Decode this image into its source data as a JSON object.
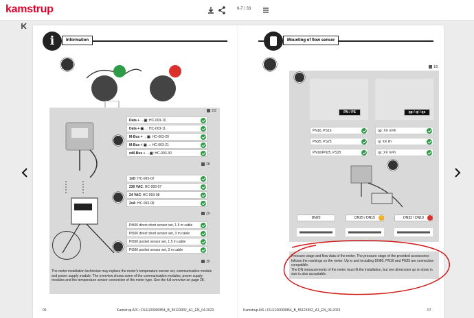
{
  "topbar": {
    "logo": "kamstrup",
    "page_indicator": "6-7 / 33",
    "icons": [
      "download-icon",
      "share-icon",
      "menu-icon"
    ]
  },
  "left_page": {
    "header": "Information",
    "table1_page": "2/2",
    "table1_rows": [
      {
        "bold": "Data + →▣",
        "text": ": HC-003-10"
      },
      {
        "bold": "Data + ▣→",
        "text": ": HC-003-11"
      },
      {
        "bold": "M-Bus + →▣",
        "text": ": HC-003-20"
      },
      {
        "bold": "M-Bus + ▣→",
        "text": ": HC-003-21"
      },
      {
        "bold": "wM-Bus + →▣",
        "text": ": HC-003-30"
      }
    ],
    "table1_ref": "28",
    "table2_rows": [
      {
        "bold": "1xD",
        "text": ": HC-993-02"
      },
      {
        "bold": "230 VAC",
        "text": ": HC-993-07"
      },
      {
        "bold": "24 VAC",
        "text": ": HC-993-08"
      },
      {
        "bold": "2xA",
        "text": ": HC-993-09"
      }
    ],
    "table2_ref": "29",
    "table3_rows": [
      {
        "bold": "",
        "text": "Pt500 direct short sensor set, 1.5 m cable"
      },
      {
        "bold": "",
        "text": "Pt500 direct short sensor set, 3 m cable"
      },
      {
        "bold": "",
        "text": "Pt500 pocket sensor set, 1.5 m cable"
      },
      {
        "bold": "",
        "text": "Pt500 pocket sensor set, 3 m cable"
      }
    ],
    "table3_ref": "30",
    "description": "The meter installation technician may replace the meter's temperature sensor set, communication module and power supply module. The overview shows some of the communication modules, power supply modules and the temperature sensor connection of the meter type. See the full overview on page 28.",
    "page_number": "06",
    "footer": "Kamstrup A/S • FILE100000854_B_55123392_A1_EN_04.2023"
  },
  "right_page": {
    "header": "Mounting of flow sensor",
    "page_ref": "1/5",
    "label_pn": "PN / PS",
    "label_qp": "qp / qi / qs",
    "pn_rows": [
      "PN16, PS16",
      "PN25, PS25",
      "PN16/PN25, PS25"
    ],
    "qp_rows": [
      "qp: XX m³/h",
      "qi: XX l/h",
      "qs: XX m³/h"
    ],
    "dn_tags": [
      "DN20",
      "DN25 / DN15",
      "DN32 / DN10"
    ],
    "description": "Pressure stage and flow data of the meter. The pressure stage of the provided accessories follows the markings on the meter. Up to and including DN80, PN16 and PN25 are connection compatible.\nThe DN measurements of the meter must fit the installation, but one dimension up or down in size is also acceptable.",
    "page_number": "07",
    "footer": "Kamstrup A/S • FILE100000854_B_55123392_A1_EN_04.2023"
  },
  "colors": {
    "brand": "#e3002b",
    "check": "#2e9c46",
    "cross": "#d9302c",
    "warn": "#f0b323",
    "annotation": "#d01818"
  }
}
